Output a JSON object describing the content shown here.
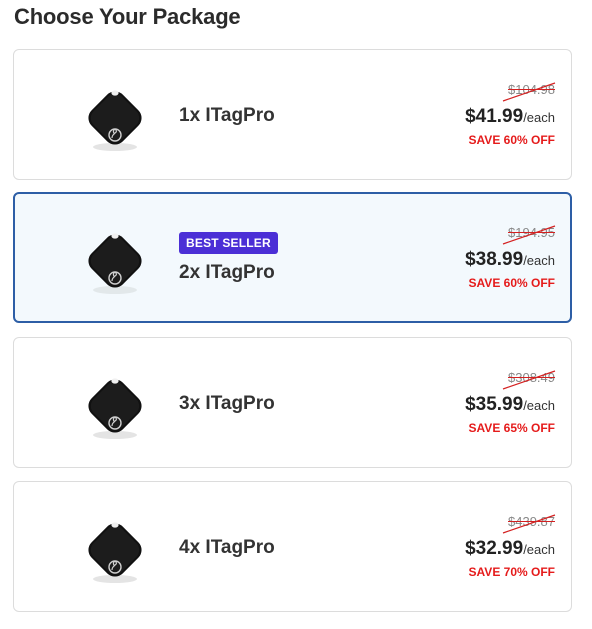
{
  "page_title": "Choose Your Package",
  "packages": [
    {
      "name": "1x ITagPro",
      "original_price": "$104.98",
      "price": "$41.99",
      "unit": "/each",
      "save": "SAVE 60% OFF",
      "badge": "",
      "selected": false
    },
    {
      "name": "2x ITagPro",
      "original_price": "$194.95",
      "price": "$38.99",
      "unit": "/each",
      "save": "SAVE 60% OFF",
      "badge": "BEST SELLER",
      "selected": true
    },
    {
      "name": "3x ITagPro",
      "original_price": "$308.49",
      "price": "$35.99",
      "unit": "/each",
      "save": "SAVE 65% OFF",
      "badge": "",
      "selected": false
    },
    {
      "name": "4x ITagPro",
      "original_price": "$439.87",
      "price": "$32.99",
      "unit": "/each",
      "save": "SAVE 70% OFF",
      "badge": "",
      "selected": false
    }
  ],
  "colors": {
    "selected_border": "#2d5ea6",
    "selected_bg": "#f3f9fd",
    "badge_bg": "#4b2fd6",
    "save_text": "#e51b1b"
  },
  "icons": {
    "product_image": "itag-tracker-icon"
  }
}
